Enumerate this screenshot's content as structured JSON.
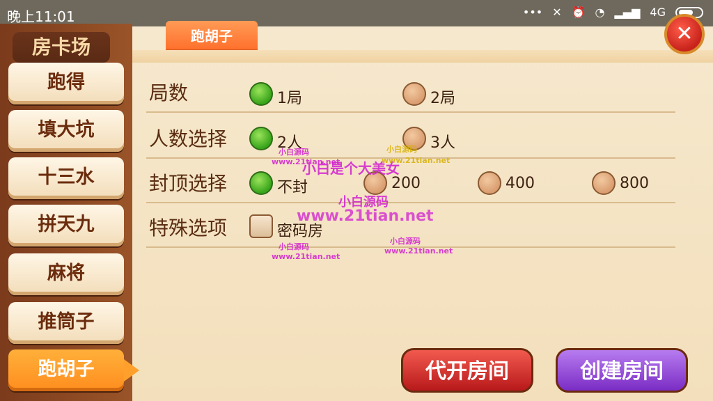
{
  "status_bar": {
    "time": "晚上11:01",
    "network": "4G"
  },
  "sidebar": {
    "header": "房卡场",
    "items": [
      {
        "label": "跑得"
      },
      {
        "label": "填大坑"
      },
      {
        "label": "十三水"
      },
      {
        "label": "拼天九"
      },
      {
        "label": "麻将"
      },
      {
        "label": "推筒子"
      },
      {
        "label": "跑胡子"
      }
    ],
    "active_index": 6
  },
  "title_tab": "跑胡子",
  "rows": {
    "rounds": {
      "label": "局数",
      "options": [
        "1局",
        "2局"
      ],
      "selected": 0
    },
    "players": {
      "label": "人数选择",
      "options": [
        "2人",
        "3人"
      ],
      "selected": 0
    },
    "cap": {
      "label": "封顶选择",
      "options": [
        "不封",
        "200",
        "400",
        "800"
      ],
      "selected": 0
    },
    "special": {
      "label": "特殊选项",
      "options": [
        "密码房"
      ],
      "checked": false
    }
  },
  "watermarks": {
    "big_text": "小白是个大美女",
    "logo_text": "小白源码",
    "url_text": "www.21tian.net",
    "small_logo": "小白源码",
    "small_url": "www.21tian.net"
  },
  "buttons": {
    "proxy_open": "代开房间",
    "create_room": "创建房间"
  },
  "colors": {
    "accent_orange": "#ff8d1e",
    "selected_green": "#38a51a",
    "create_purple": "#7a2cc4",
    "proxy_red": "#b8191b"
  }
}
